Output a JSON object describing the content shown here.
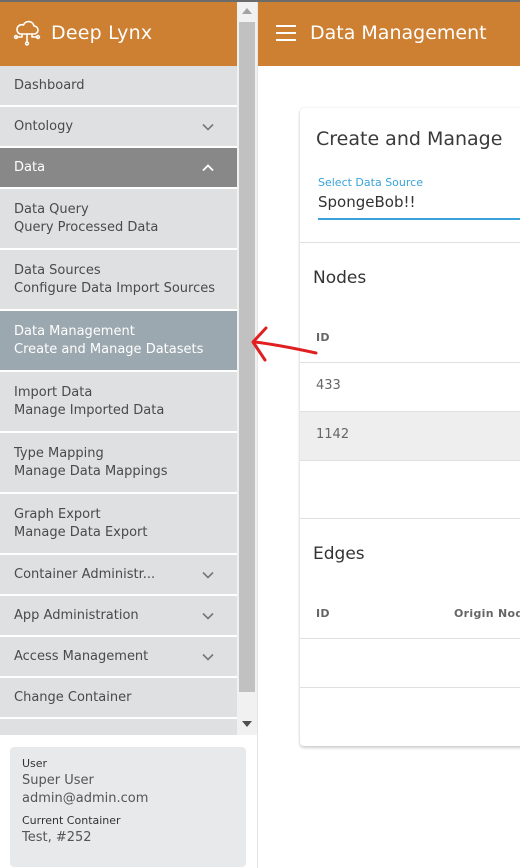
{
  "brand": {
    "name": "Deep Lynx",
    "icon": "cloud-network-icon"
  },
  "appbar": {
    "title": "Data Management",
    "menu_icon": "hamburger-icon"
  },
  "sidebar": {
    "items": [
      {
        "label": "Dashboard"
      },
      {
        "label": "Ontology",
        "icon": "chevron-down-icon"
      },
      {
        "label": "Data",
        "icon": "chevron-up-icon",
        "expanded": true
      },
      {
        "label": "Data Query",
        "sub": "Query Processed Data"
      },
      {
        "label": "Data Sources",
        "sub": "Configure Data Import Sources"
      },
      {
        "label": "Data Management",
        "sub": "Create and Manage Datasets",
        "active": true
      },
      {
        "label": "Import Data",
        "sub": "Manage Imported Data"
      },
      {
        "label": "Type Mapping",
        "sub": "Manage Data Mappings"
      },
      {
        "label": "Graph Export",
        "sub": "Manage Data Export"
      },
      {
        "label": "Container Administr...",
        "icon": "chevron-down-icon"
      },
      {
        "label": "App Administration",
        "icon": "chevron-down-icon"
      },
      {
        "label": "Access Management",
        "icon": "chevron-down-icon"
      },
      {
        "label": "Change Container"
      }
    ]
  },
  "user_card": {
    "user_label": "User",
    "user_name": "Super User",
    "user_email": "admin@admin.com",
    "container_label": "Current Container",
    "container_value": "Test, #252"
  },
  "main": {
    "card_title": "Create and Manage",
    "select": {
      "label": "Select Data Source",
      "value": "SpongeBob!!"
    },
    "nodes": {
      "title": "Nodes",
      "columns": [
        "ID"
      ],
      "rows": [
        {
          "id": "433"
        },
        {
          "id": "1142"
        }
      ]
    },
    "edges": {
      "title": "Edges",
      "columns": [
        "ID",
        "Origin Nod"
      ],
      "rows": []
    }
  },
  "colors": {
    "brand": "#cd7f32",
    "nav_bg": "#dfe0e1",
    "nav_group_open": "#888888",
    "nav_active": "#9ba8af",
    "accent": "#38a3d8",
    "annotation": "#e02020"
  }
}
